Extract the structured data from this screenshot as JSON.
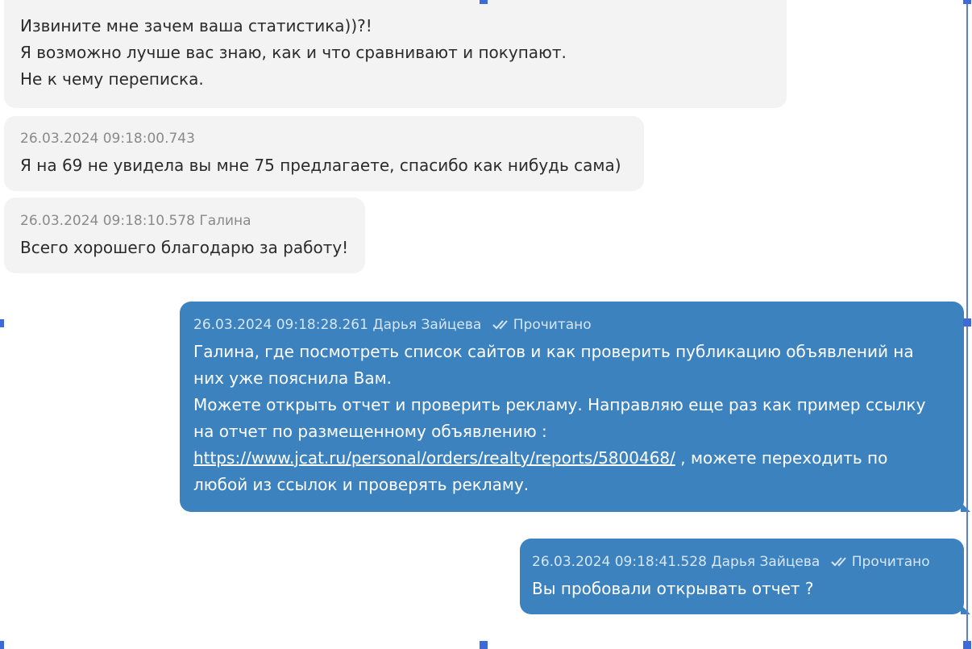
{
  "messages": [
    {
      "lines": [
        "Извините мне зачем ваша статистика))?!",
        "Я возможно лучше вас знаю, как и что сравнивают и покупают.",
        "Не к чему переписка."
      ]
    },
    {
      "timestamp": "26.03.2024 09:18:00.743",
      "text": "Я на 69 не увидела вы мне 75 предлагаете, спасибо как нибудь сама)"
    },
    {
      "timestamp": "26.03.2024 09:18:10.578",
      "author": "Галина",
      "text": "Всего хорошего благодарю за работу!"
    },
    {
      "timestamp": "26.03.2024 09:18:28.261",
      "author": "Дарья Зайцева",
      "status": "Прочитано",
      "line1": "Галина, где посмотреть список сайтов и как проверить публикацию объявлений на",
      "line2": "них уже пояснила Вам.",
      "line3": "Можете открыть отчет и проверить рекламу. Направляю еще раз как пример ссылку",
      "line4": "на отчет по размещенному объявлению :",
      "link": "https://www.jcat.ru/personal/orders/realty/reports/5800468/",
      "after_link": " , можете переходить по",
      "line6": "любой из ссылок и проверять рекламу."
    },
    {
      "timestamp": "26.03.2024 09:18:41.528",
      "author": "Дарья Зайцева",
      "status": "Прочитано",
      "text": "Вы пробовали открывать отчет ?"
    }
  ],
  "colors": {
    "incoming_bg": "#f3f3f4",
    "outgoing_bg": "#3c82be",
    "selection": "#3d6ad8"
  },
  "icons": {
    "read_status": "double-check-icon"
  }
}
